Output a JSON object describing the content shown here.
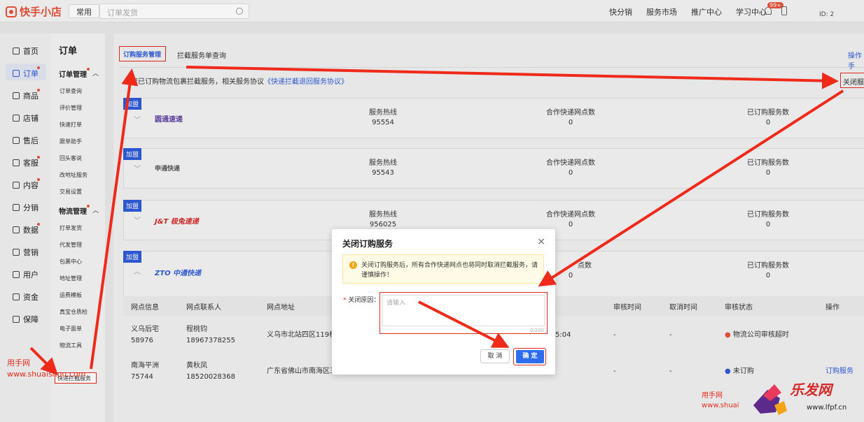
{
  "brand": "快手小店",
  "topbar": {
    "common_tab": "常用",
    "search_placeholder": "订单发货",
    "links": [
      "快分销",
      "服务市场",
      "推广中心",
      "学习中心"
    ],
    "badge": "99+",
    "user_id": "ID:            2"
  },
  "nav1": [
    "首页",
    "订单",
    "商品",
    "店铺",
    "售后",
    "客服",
    "内容",
    "分销",
    "数据",
    "营销",
    "用户",
    "资金",
    "保障"
  ],
  "nav2": {
    "title": "订单",
    "group1": "订单管理",
    "group1_items": [
      "订单查询",
      "评价管理",
      "快速打单",
      "跟单助手",
      "回头客说",
      "改地址服务",
      "交易设置"
    ],
    "group2": "物流管理",
    "group2_items": [
      "打单发货",
      "代发管理",
      "包裹中心",
      "地址管理",
      "运费模板",
      "真宝仓质检",
      "电子面单",
      "物流工具"
    ],
    "selected": "快递拦截服务"
  },
  "tabs": {
    "active": "订购服务管理",
    "second": "拦截服务单查询",
    "more": "操作手"
  },
  "notice": {
    "text": "您已订购物流包裹拦截服务，相关服务协议",
    "link": "《快递拦截退回服务协议》"
  },
  "close_service": "关闭服务",
  "cards": [
    {
      "tag": "加盟",
      "carrier": "圆通速递",
      "hotline_label": "服务热线",
      "hotline": "95554",
      "outlets_label": "合作快递网点数",
      "outlets": "0",
      "subs_label": "已订购服务数",
      "subs": "0"
    },
    {
      "tag": "加盟",
      "carrier": "申通快递",
      "hotline_label": "服务热线",
      "hotline": "95543",
      "outlets_label": "合作快递网点数",
      "outlets": "0",
      "subs_label": "已订购服务数",
      "subs": "0"
    },
    {
      "tag": "加盟",
      "carrier": "J&T 极兔速递",
      "hotline_label": "服务热线",
      "hotline": "956025",
      "outlets_label": "合作快递网点数",
      "outlets": "0",
      "subs_label": "已订购服务数",
      "subs": "0"
    },
    {
      "tag": "加盟",
      "carrier": "ZTO 中通快递",
      "hotline_label": "",
      "hotline": "",
      "outlets_label": "点数",
      "outlets": "0",
      "subs_label": "已订购服务数",
      "subs": "0"
    }
  ],
  "table": {
    "headers": [
      "网点信息",
      "网点联系人",
      "网点地址",
      "审核时间",
      "取消时间",
      "审核状态",
      "操作"
    ],
    "rows": [
      {
        "outlet": "义乌后宅",
        "code": "58976",
        "contact": "程桃钧",
        "phone": "18967378255",
        "address": "义乌市北站四区119栋",
        "time": "5:04",
        "audit": "-",
        "cancel": "-",
        "status": "物流公司审核超时",
        "op": ""
      },
      {
        "outlet": "南海平洲",
        "code": "75744",
        "contact": "黄秋凤",
        "phone": "18520028368",
        "address": "广东省佛山市南海区三",
        "time": "",
        "audit": "-",
        "cancel": "-",
        "status": "未订购",
        "op": "订购服务"
      }
    ]
  },
  "modal": {
    "title": "关闭订购服务",
    "warning": "关闭订购服务后，所有合作快递网点也将同时取消拦截服务，请谨慎操作！",
    "reason_label": "关闭原因：",
    "placeholder": "请输入",
    "counter": "0/200",
    "cancel": "取 消",
    "confirm": "确 定"
  },
  "watermark": {
    "left_name": "用手网",
    "left_url": "www.shuaishou.com",
    "right_name": "用手网",
    "right_url": "www.shuai",
    "brand": "乐发网",
    "brand_url": "www.lfpf.cn"
  }
}
